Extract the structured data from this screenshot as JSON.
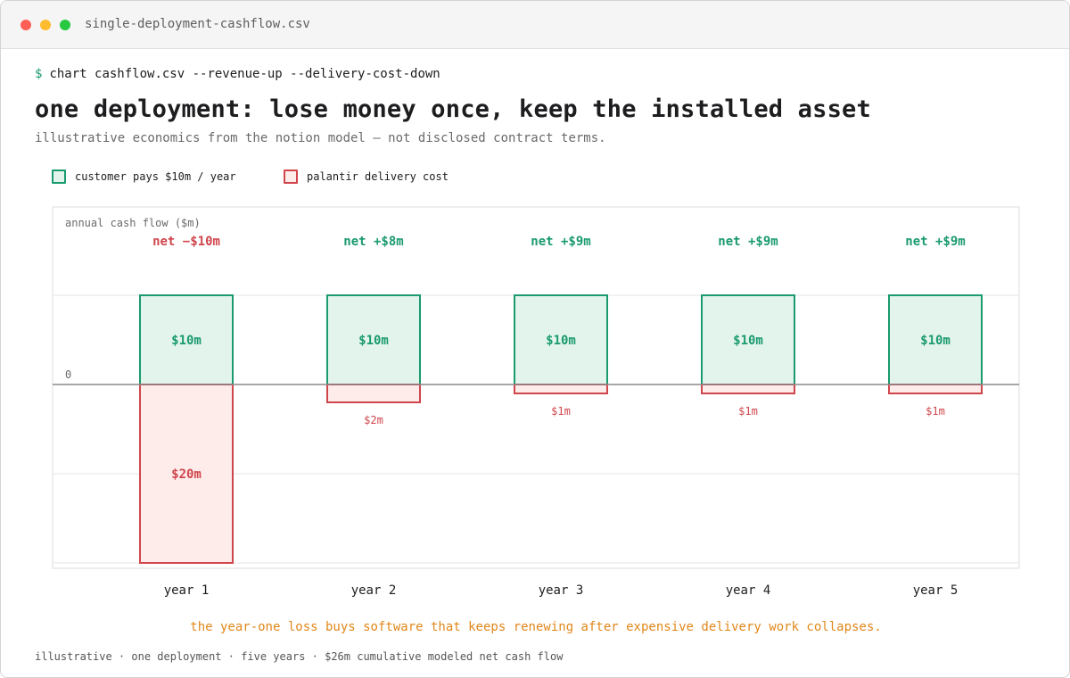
{
  "window": {
    "title": "single-deployment-cashflow.csv"
  },
  "command": {
    "prompt": "$",
    "text": "chart cashflow.csv --revenue-up --delivery-cost-down"
  },
  "headline": "one deployment: lose money once, keep the installed asset",
  "subtitle": "illustrative economics from the notion model — not disclosed contract terms.",
  "legend": {
    "revenue_label": "customer pays $10m / year",
    "cost_label": "palantir delivery cost"
  },
  "colors": {
    "revenue_stroke": "#1a9a6f",
    "revenue_fill": "#e3f4ec",
    "cost_stroke": "#d0454c",
    "cost_fill": "#fdecea",
    "caption": "#e0871a"
  },
  "chart_data": {
    "type": "bar",
    "ylabel": "annual cash flow ($m)",
    "zero_label": "0",
    "ylim": [
      -20,
      20
    ],
    "grid": true,
    "categories": [
      "year 1",
      "year 2",
      "year 3",
      "year 4",
      "year 5"
    ],
    "series": [
      {
        "name": "customer pays $10m / year",
        "values": [
          10,
          10,
          10,
          10,
          10
        ],
        "labels": [
          "$10m",
          "$10m",
          "$10m",
          "$10m",
          "$10m"
        ]
      },
      {
        "name": "palantir delivery cost",
        "values": [
          -20,
          -2,
          -1,
          -1,
          -1
        ],
        "labels": [
          "$20m",
          "$2m",
          "$1m",
          "$1m",
          "$1m"
        ]
      }
    ],
    "net": [
      -10,
      8,
      9,
      9,
      9
    ],
    "net_labels": [
      "net −$10m",
      "net +$8m",
      "net +$9m",
      "net +$9m",
      "net +$9m"
    ]
  },
  "caption": "the year-one loss buys software that keeps renewing after expensive delivery work collapses.",
  "footer": "illustrative · one deployment · five years · $26m cumulative modeled net cash flow"
}
